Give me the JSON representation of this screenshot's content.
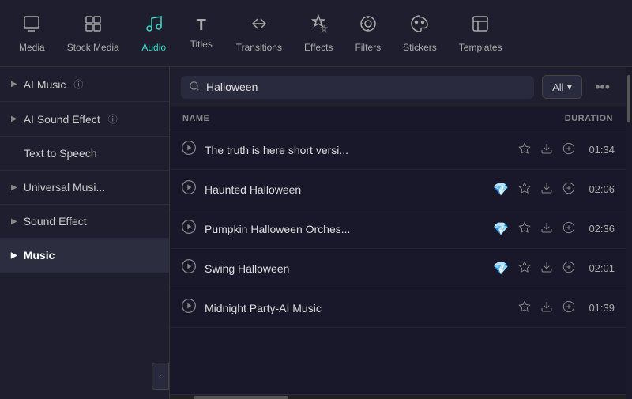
{
  "nav": {
    "items": [
      {
        "id": "media",
        "label": "Media",
        "icon": "🖼",
        "active": false
      },
      {
        "id": "stock-media",
        "label": "Stock Media",
        "icon": "🗂",
        "active": false
      },
      {
        "id": "audio",
        "label": "Audio",
        "icon": "♪",
        "active": true
      },
      {
        "id": "titles",
        "label": "Titles",
        "icon": "T",
        "active": false
      },
      {
        "id": "transitions",
        "label": "Transitions",
        "icon": "↔",
        "active": false
      },
      {
        "id": "effects",
        "label": "Effects",
        "icon": "✦",
        "active": false
      },
      {
        "id": "filters",
        "label": "Filters",
        "icon": "◈",
        "active": false
      },
      {
        "id": "stickers",
        "label": "Stickers",
        "icon": "❋",
        "active": false
      },
      {
        "id": "templates",
        "label": "Templates",
        "icon": "▣",
        "active": false
      }
    ]
  },
  "sidebar": {
    "items": [
      {
        "id": "ai-music",
        "label": "AI Music",
        "hasChevron": true,
        "hasInfo": true,
        "active": false
      },
      {
        "id": "ai-sound-effect",
        "label": "AI Sound Effect",
        "hasChevron": true,
        "hasInfo": true,
        "active": false
      },
      {
        "id": "text-to-speech",
        "label": "Text to Speech",
        "hasChevron": false,
        "hasInfo": false,
        "active": false
      },
      {
        "id": "universal-music",
        "label": "Universal Musi...",
        "hasChevron": true,
        "hasInfo": false,
        "active": false
      },
      {
        "id": "sound-effect",
        "label": "Sound Effect",
        "hasChevron": true,
        "hasInfo": false,
        "active": false
      },
      {
        "id": "music",
        "label": "Music",
        "hasChevron": true,
        "hasInfo": false,
        "active": true
      }
    ],
    "collapse_label": "‹"
  },
  "search": {
    "placeholder": "Halloween",
    "value": "Halloween",
    "filter_label": "All",
    "more_icon": "•••"
  },
  "table": {
    "col_name": "NAME",
    "col_duration": "DURATION"
  },
  "tracks": [
    {
      "id": 1,
      "name": "The truth is here short versi...",
      "has_gem": false,
      "duration": "01:34"
    },
    {
      "id": 2,
      "name": "Haunted Halloween",
      "has_gem": true,
      "duration": "02:06"
    },
    {
      "id": 3,
      "name": "Pumpkin Halloween Orches...",
      "has_gem": true,
      "duration": "02:36"
    },
    {
      "id": 4,
      "name": "Swing Halloween",
      "has_gem": true,
      "duration": "02:01"
    },
    {
      "id": 5,
      "name": "Midnight Party-AI Music",
      "has_gem": false,
      "duration": "01:39"
    }
  ]
}
